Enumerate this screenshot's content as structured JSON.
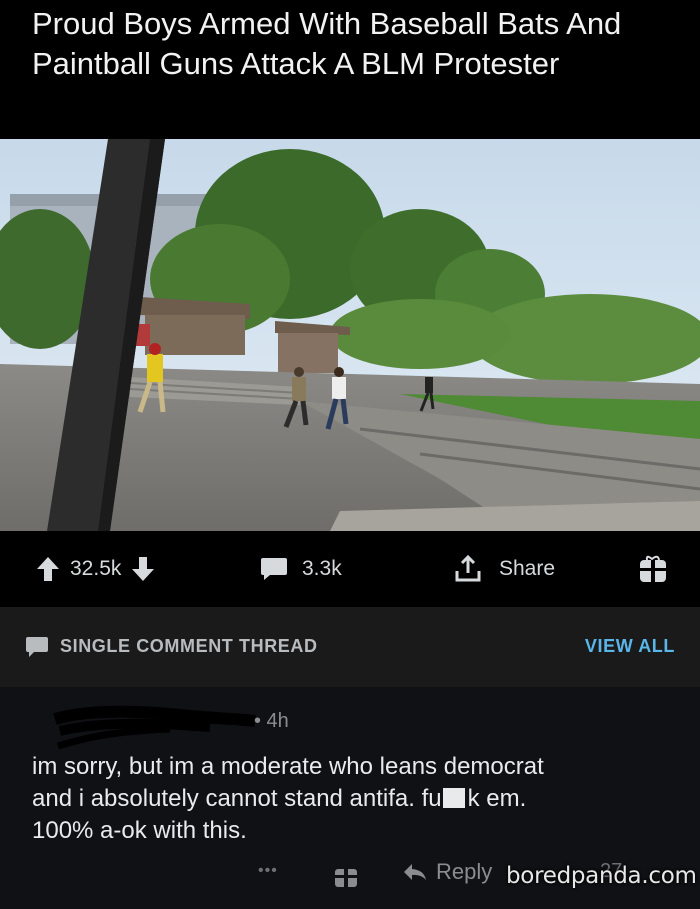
{
  "post": {
    "title": "Proud Boys Armed With Baseball Bats And Paintball Guns Attack A BLM Protester"
  },
  "video": {
    "muted": true,
    "mute_icon": "speaker-muted-icon"
  },
  "actions": {
    "upvotes": "32.5k",
    "comments": "3.3k",
    "share_label": "Share",
    "gift_icon": "gift-icon"
  },
  "thread": {
    "label": "SINGLE COMMENT THREAD",
    "view_all": "VIEW ALL",
    "accent_color": "#5ab5e8"
  },
  "comment": {
    "time": "• 4h",
    "body": "im sorry, but im a moderate who leans democrat and i absolutely cannot stand antifa. fu█k em. 100% a-ok with this.",
    "body_lines": [
      "im sorry, but im a moderate who leans democrat",
      "and i absolutely cannot stand antifa. fu",
      "k em.",
      "100% a-ok with this."
    ],
    "more_label": "•••",
    "reply_label": "Reply",
    "vote_count": "27"
  },
  "watermark": "boredpanda.com"
}
